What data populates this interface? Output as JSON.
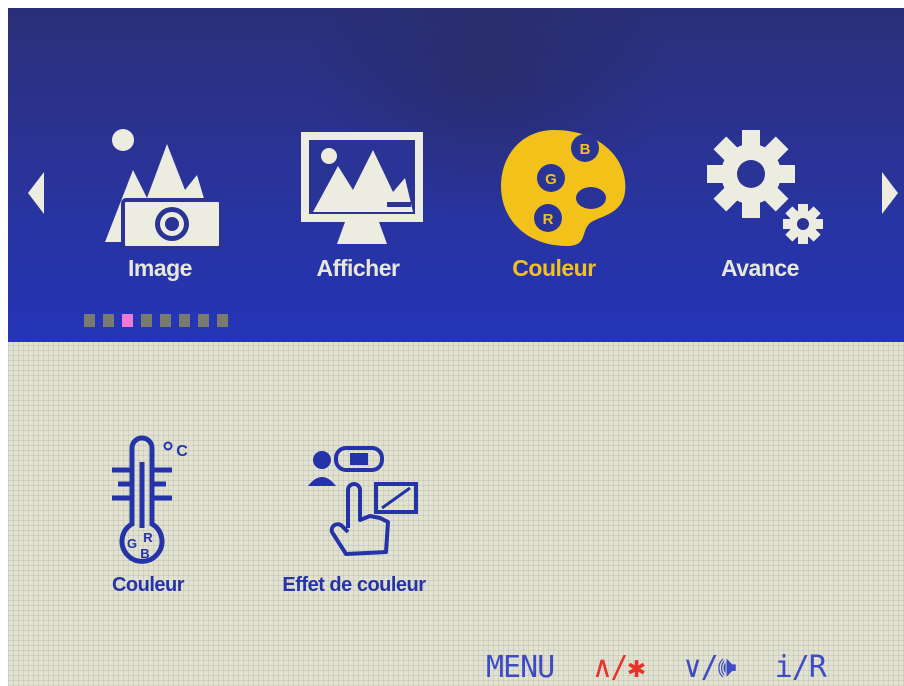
{
  "colors": {
    "bar_blue": "#2a3396",
    "active_yellow": "#f2c21a",
    "inactive_label": "#e8e8d8",
    "sub_label_blue": "#2434a8",
    "dot_active": "#f07ad8",
    "hint_red": "#e8322a"
  },
  "nav": {
    "left_arrow_icon": "triangle-left-icon",
    "right_arrow_icon": "triangle-right-icon"
  },
  "menu": {
    "items": [
      {
        "label": "Image",
        "icon": "mountain-camera-icon",
        "active": false
      },
      {
        "label": "Afficher",
        "icon": "monitor-landscape-icon",
        "active": false
      },
      {
        "label": "Couleur",
        "icon": "palette-rgb-icon",
        "active": true
      },
      {
        "label": "Avance",
        "icon": "gears-icon",
        "active": false
      }
    ],
    "pages_total": 8,
    "page_active": 2
  },
  "submenu": {
    "items": [
      {
        "label": "Couleur",
        "icon": "thermometer-rgb-icon"
      },
      {
        "label": "Effet de couleur",
        "icon": "color-effect-hand-icon"
      }
    ]
  },
  "hints": {
    "menu": "MENU",
    "up": "∧/✱",
    "down": "∨/🕪",
    "info": "i/R"
  }
}
